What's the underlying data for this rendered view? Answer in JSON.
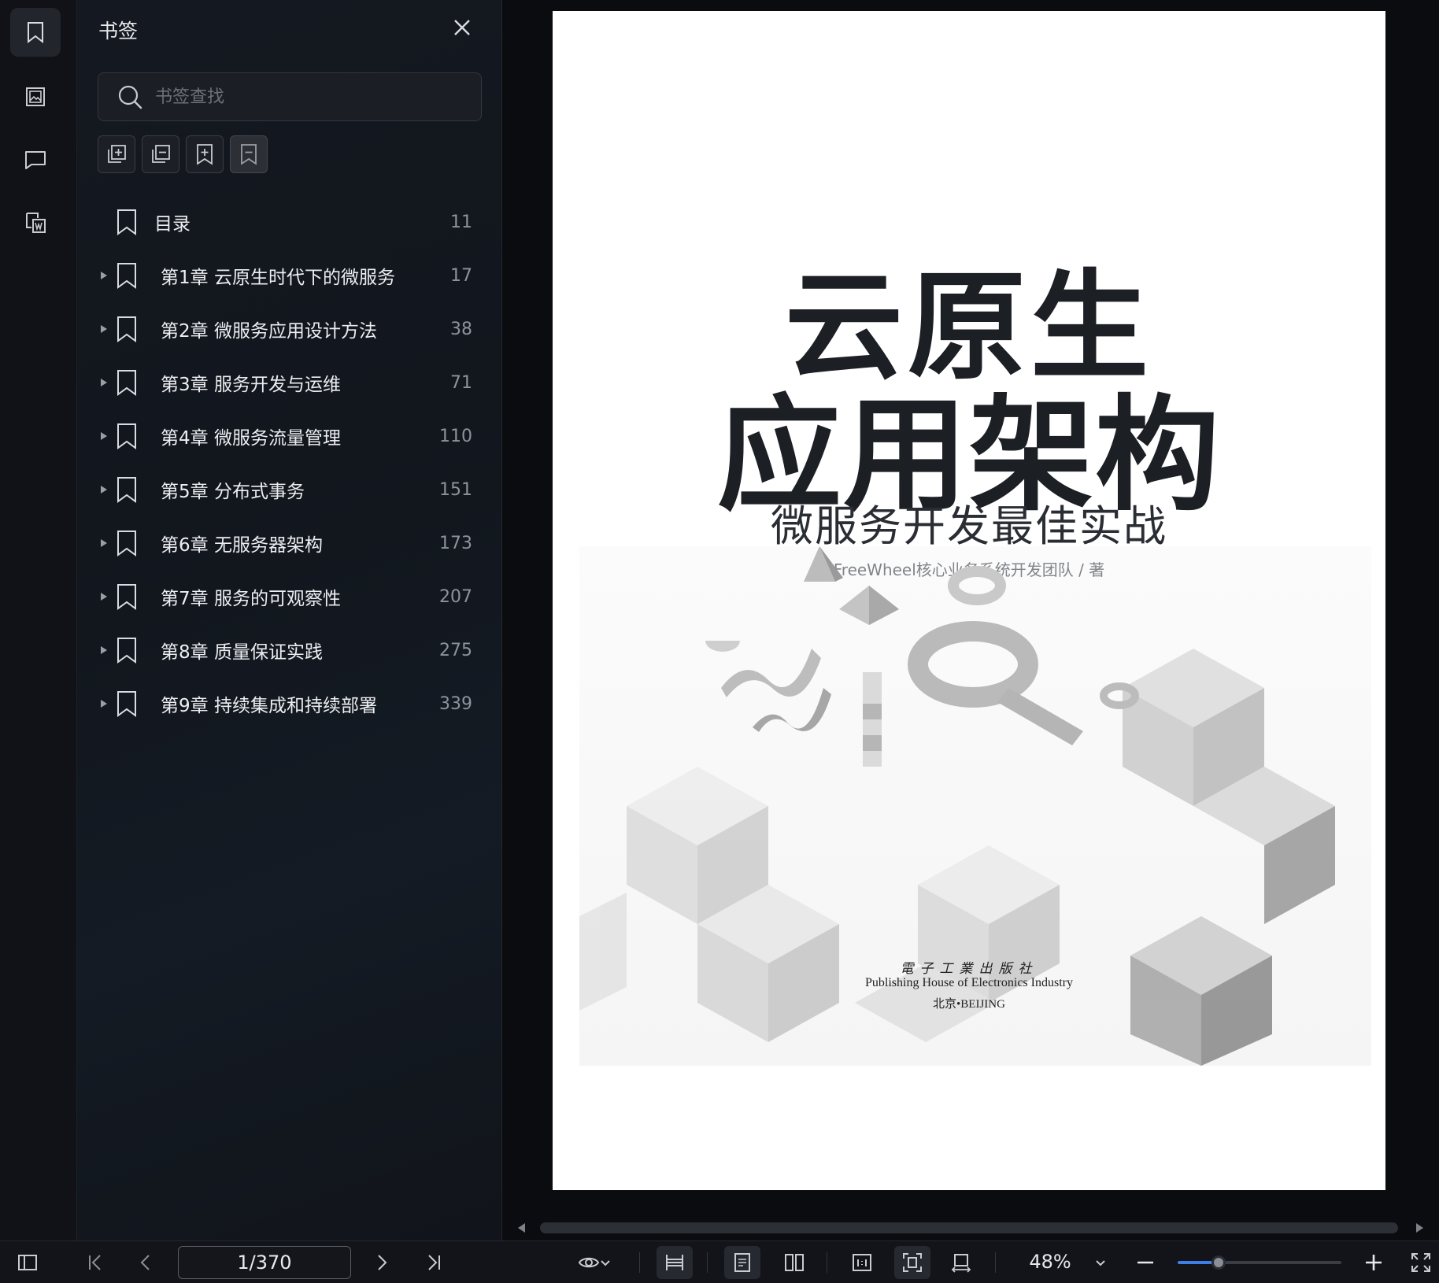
{
  "sidebar_panel": {
    "title": "书签",
    "search_placeholder": "书签查找",
    "bookmarks": [
      {
        "label": "目录",
        "page": "11",
        "expandable": false
      },
      {
        "label": "第1章 云原生时代下的微服务",
        "page": "17",
        "expandable": true
      },
      {
        "label": "第2章 微服务应用设计方法",
        "page": "38",
        "expandable": true
      },
      {
        "label": "第3章 服务开发与运维",
        "page": "71",
        "expandable": true
      },
      {
        "label": "第4章 微服务流量管理",
        "page": "110",
        "expandable": true
      },
      {
        "label": "第5章 分布式事务",
        "page": "151",
        "expandable": true
      },
      {
        "label": "第6章 无服务器架构",
        "page": "173",
        "expandable": true
      },
      {
        "label": "第7章 服务的可观察性",
        "page": "207",
        "expandable": true
      },
      {
        "label": "第8章 质量保证实践",
        "page": "275",
        "expandable": true
      },
      {
        "label": "第9章 持续集成和持续部署",
        "page": "339",
        "expandable": true
      }
    ]
  },
  "cover": {
    "title_line1": "云原生",
    "title_line2": "应用架构",
    "subtitle": "微服务开发最佳实战",
    "author": "FreeWheel核心业务系统开发团队 / 著",
    "publisher_cn": "電子工業出版社",
    "publisher_en": "Publishing House of Electronics Industry",
    "publisher_city": "北京•BEIJING"
  },
  "toolbar": {
    "page_indicator": "1/370",
    "zoom": "48%",
    "zoom_fraction": 0.25
  },
  "icons": {
    "rail": [
      "bookmark-icon",
      "image-icon",
      "comment-icon",
      "word-convert-icon"
    ],
    "tools": [
      "expand-all-icon",
      "collapse-all-icon",
      "add-bookmark-icon",
      "remove-bookmark-icon"
    ]
  },
  "colors": {
    "accent": "#3f7ee8",
    "background": "#0d0f13",
    "panel": "#141820"
  }
}
